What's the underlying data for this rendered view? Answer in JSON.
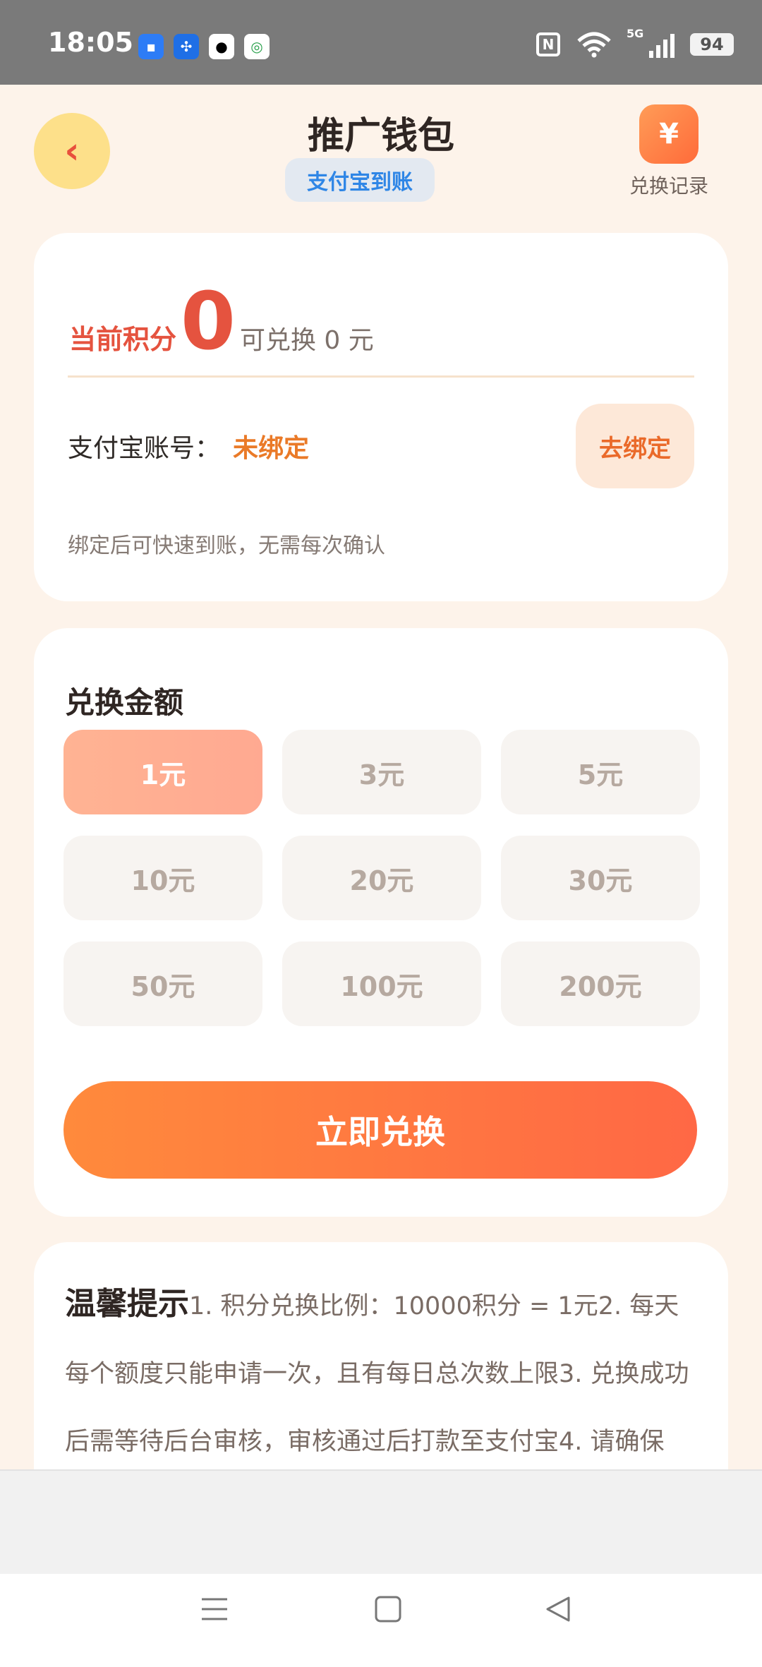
{
  "status_bar": {
    "time": "18:05",
    "network": "5G",
    "battery": "94",
    "notification_icons": [
      "message-icon",
      "pinwheel-icon",
      "qq-penguin-icon",
      "china-mobile-icon"
    ]
  },
  "header": {
    "title": "推广钱包",
    "subtitle": "支付宝到账",
    "back_icon": "‹",
    "record_icon": "¥",
    "record_label": "兑换记录"
  },
  "points_card": {
    "label": "当前积分",
    "value": "0",
    "redeemable": "可兑换 0 元",
    "alipay_label": "支付宝账号：",
    "alipay_status": "未绑定",
    "bind_button": "去绑定",
    "hint": "绑定后可快速到账，无需每次确认"
  },
  "exchange_card": {
    "title": "兑换金额",
    "amounts": [
      "1元",
      "3元",
      "5元",
      "10元",
      "20元",
      "30元",
      "50元",
      "100元",
      "200元"
    ],
    "selected": "1元",
    "submit_label": "立即兑换"
  },
  "tips": {
    "title": "温馨提示",
    "text": "1. 积分兑换比例：10000积分 = 1元2. 每天每个额度只能申请一次，且有每日总次数上限3. 兑换成功后需等待后台审核，审核通过后打款至支付宝4. 请确保"
  },
  "colors": {
    "accent": "#e5533f",
    "orange": "#ff7a40",
    "background": "#fdf3ea",
    "alipay_blue": "#2f86e6"
  }
}
